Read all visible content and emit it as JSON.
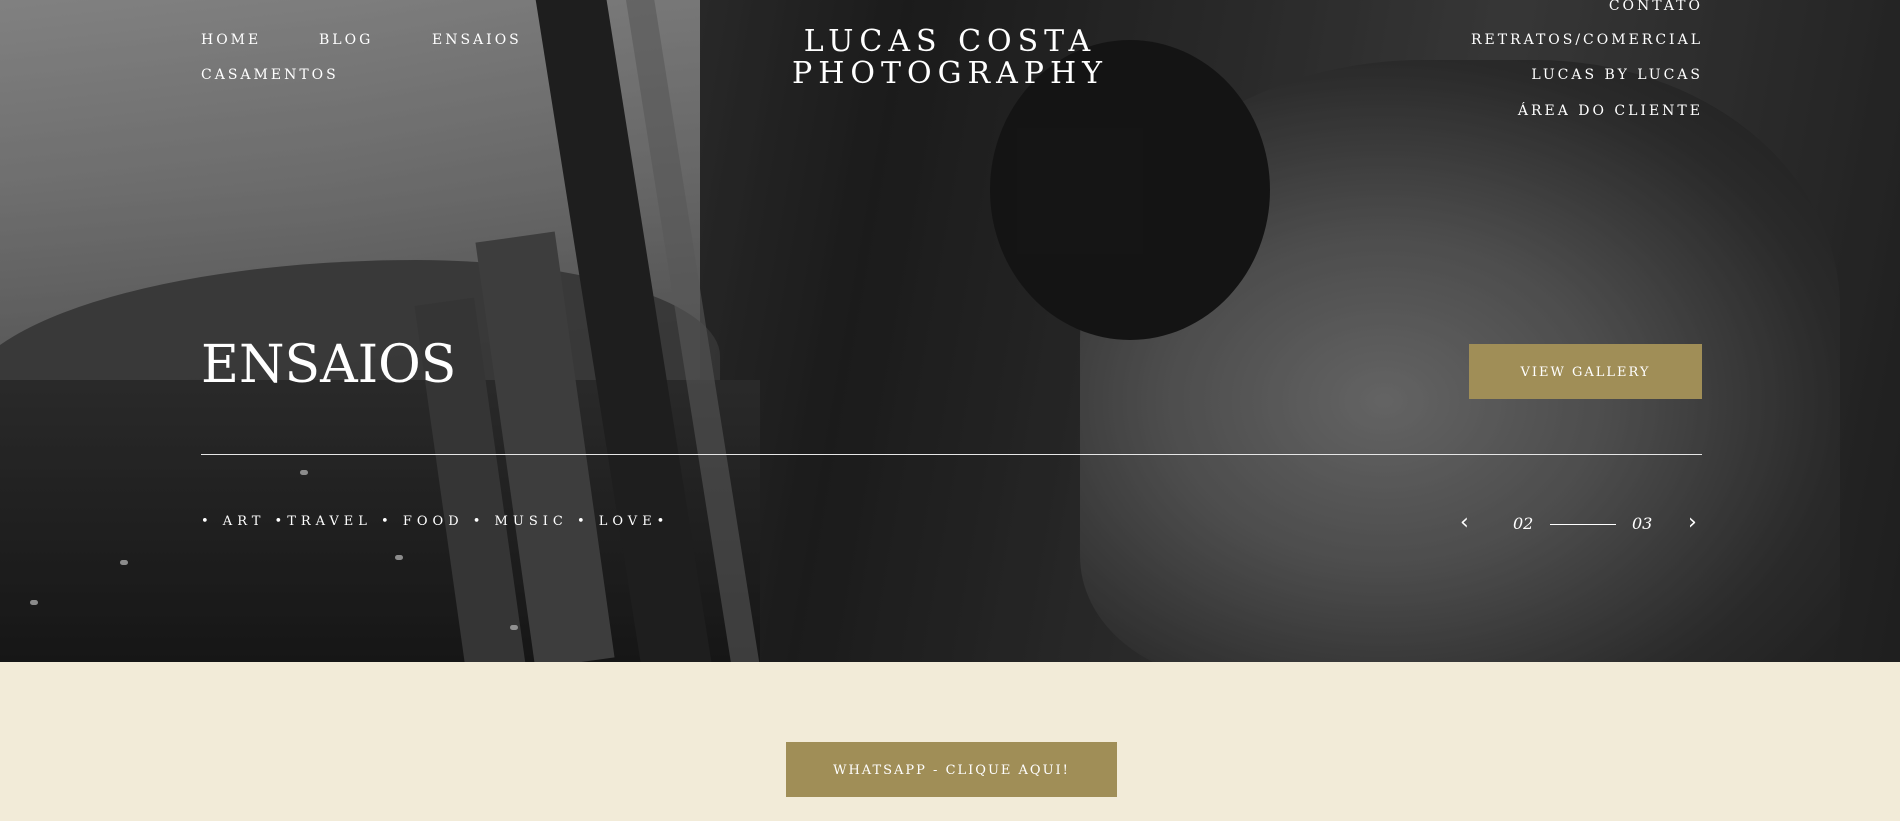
{
  "nav_left": [
    {
      "label": "HOME"
    },
    {
      "label": "BLOG"
    },
    {
      "label": "ENSAIOS"
    },
    {
      "label": "CASAMENTOS"
    }
  ],
  "brand": {
    "line1": "LUCAS COSTA",
    "line2": "PHOTOGRAPHY"
  },
  "nav_right": [
    {
      "label": "CONTATO"
    },
    {
      "label": "RETRATOS/COMERCIAL"
    },
    {
      "label": "LUCAS BY LUCAS"
    },
    {
      "label": "ÁREA DO CLIENTE"
    }
  ],
  "hero": {
    "title": "ENSAIOS",
    "button_label": "VIEW GALLERY",
    "tags": "• ART •TRAVEL • FOOD • MUSIC • LOVE•",
    "slider": {
      "current": "02",
      "total": "03",
      "prev_icon": "chevron-left-icon",
      "next_icon": "chevron-right-icon"
    }
  },
  "cta": {
    "label": "WHATSAPP - CLIQUE AQUI!"
  },
  "colors": {
    "accent": "#a08e57",
    "footer_bg": "#f2ebd8"
  }
}
